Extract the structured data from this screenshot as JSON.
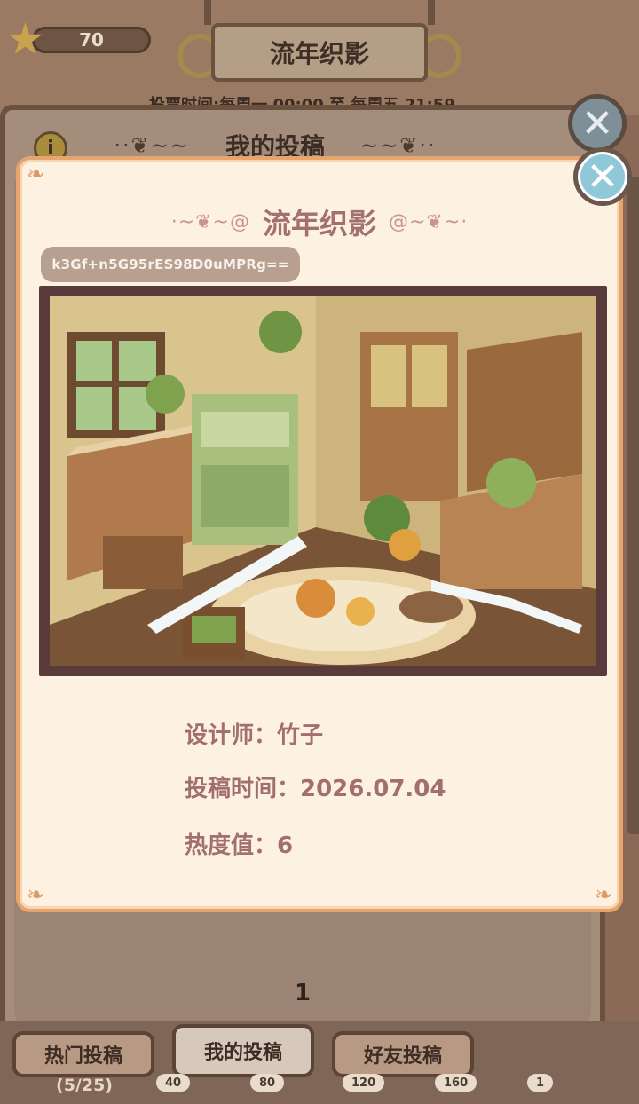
{
  "background": {
    "star_count": "70",
    "event_title": "流年织影",
    "vote_time": "投票时间:每周一 00:00 至 每周五 21:59",
    "panel_heading": "我的投稿",
    "info_icon": "i",
    "page_number": "1",
    "tabs": [
      {
        "label": "热门投稿"
      },
      {
        "label": "我的投稿"
      },
      {
        "label": "好友投稿"
      }
    ],
    "submission_count": "(5/25)",
    "rewards": [
      "40",
      "80",
      "120",
      "160",
      "1"
    ]
  },
  "modal": {
    "title": "流年织影",
    "share_code": "k3Gf+n5G95rES98D0uMPRg==",
    "designer": "设计师：竹子",
    "submit_time": "投稿时间：2026.07.04",
    "heat": "热度值：6"
  },
  "icons": {
    "star": "star-icon",
    "close": "close-icon",
    "info": "info-icon"
  },
  "colors": {
    "modal_bg": "#fdf1e2",
    "modal_border": "#e7a46c",
    "title_text": "#a2706f",
    "close_button": "#8fc8d8",
    "code_pill": "#b7a090"
  }
}
